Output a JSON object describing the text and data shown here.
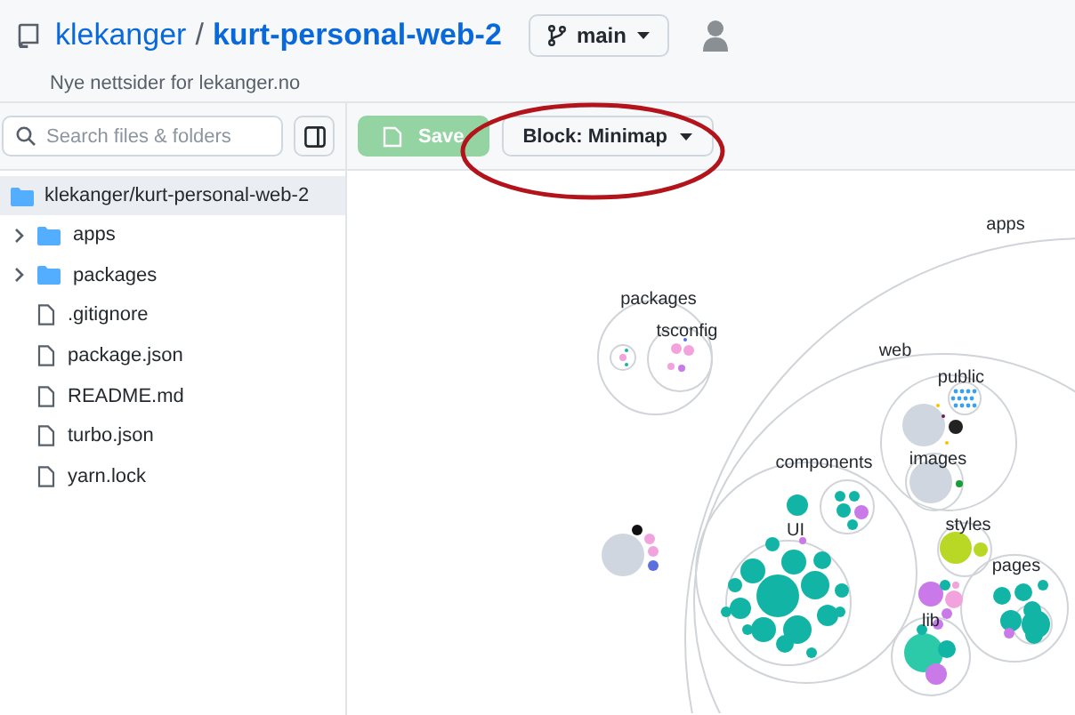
{
  "repo": {
    "owner": "klekanger",
    "separator": "/",
    "name": "kurt-personal-web-2",
    "description": "Nye nettsider for lekanger.no"
  },
  "branch": {
    "label": "main"
  },
  "search": {
    "placeholder": "Search files & folders"
  },
  "save_button": {
    "label": "Save",
    "disabled": true
  },
  "block_menu": {
    "label": "Block: Minimap"
  },
  "tree": {
    "root": {
      "label": "klekanger/kurt-personal-web-2",
      "selected": true
    },
    "items": [
      {
        "label": "apps",
        "kind": "folder",
        "expanded": false
      },
      {
        "label": "packages",
        "kind": "folder",
        "expanded": false
      },
      {
        "label": ".gitignore",
        "kind": "file"
      },
      {
        "label": "package.json",
        "kind": "file"
      },
      {
        "label": "README.md",
        "kind": "file"
      },
      {
        "label": "turbo.json",
        "kind": "file"
      },
      {
        "label": "yarn.lock",
        "kind": "file"
      }
    ]
  },
  "minimap": {
    "labels": [
      "apps",
      "packages",
      "tsconfig",
      "web",
      "public",
      "images",
      "components",
      "UI",
      "styles",
      "pages",
      "lib"
    ]
  }
}
